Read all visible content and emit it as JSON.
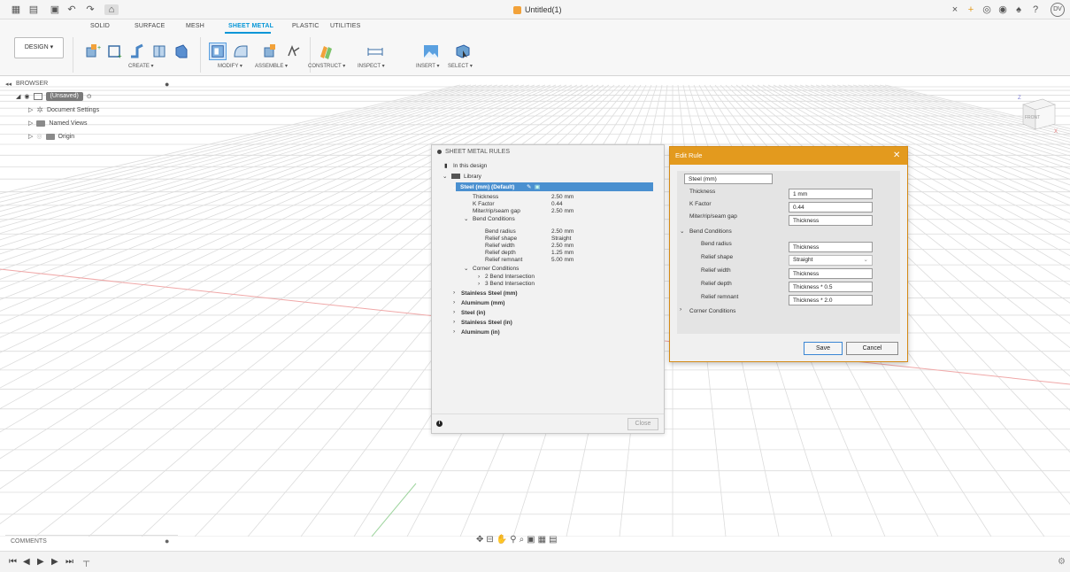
{
  "document": {
    "title": "Untitled(1)"
  },
  "user": {
    "initials": "DV"
  },
  "ribbon": {
    "tabs": [
      "SOLID",
      "SURFACE",
      "MESH",
      "SHEET METAL",
      "PLASTIC",
      "UTILITIES"
    ],
    "active_tab": "SHEET METAL",
    "design_button": "DESIGN ▾",
    "groups": [
      "CREATE ▾",
      "MODIFY ▾",
      "ASSEMBLE ▾",
      "CONSTRUCT ▾",
      "INSPECT ▾",
      "INSERT ▾",
      "SELECT ▾"
    ]
  },
  "browser": {
    "header": "BROWSER",
    "root": "(Unsaved)",
    "items": [
      "Document Settings",
      "Named Views",
      "Origin"
    ]
  },
  "sheet_metal_rules": {
    "title": "SHEET METAL RULES",
    "in_this_design": "In this design",
    "library": "Library",
    "selected_rule": "Steel (mm) (Default)",
    "props": [
      {
        "label": "Thickness",
        "value": "2.50 mm"
      },
      {
        "label": "K Factor",
        "value": "0.44"
      },
      {
        "label": "Miter/rip/seam gap",
        "value": "2.50 mm"
      }
    ],
    "bend_conditions": "Bend Conditions",
    "bend_props": [
      {
        "label": "Bend radius",
        "value": "2.50 mm"
      },
      {
        "label": "Relief shape",
        "value": "Straight"
      },
      {
        "label": "Relief width",
        "value": "2.50 mm"
      },
      {
        "label": "Relief depth",
        "value": "1.25 mm"
      },
      {
        "label": "Relief remnant",
        "value": "5.00 mm"
      }
    ],
    "corner_conditions": "Corner Conditions",
    "corner_items": [
      "2 Bend Intersection",
      "3 Bend Intersection"
    ],
    "other_rules": [
      "Stainless Steel (mm)",
      "Aluminum (mm)",
      "Steel (in)",
      "Stainless Steel (in)",
      "Aluminum (in)"
    ],
    "close_label": "Close"
  },
  "edit_rule": {
    "title": "Edit Rule",
    "name_value": "Steel (mm)",
    "fields": [
      {
        "label": "Thickness",
        "value": "1 mm"
      },
      {
        "label": "K Factor",
        "value": "0.44"
      },
      {
        "label": "Miter/rip/seam gap",
        "value": "Thickness"
      }
    ],
    "bend_conditions": "Bend Conditions",
    "bend_fields": [
      {
        "label": "Bend radius",
        "value": "Thickness"
      },
      {
        "label": "Relief shape",
        "value": "Straight"
      },
      {
        "label": "Relief width",
        "value": "Thickness"
      },
      {
        "label": "Relief depth",
        "value": "Thickness * 0.5"
      },
      {
        "label": "Relief remnant",
        "value": "Thickness * 2.0"
      }
    ],
    "corner_conditions": "Corner Conditions",
    "save_label": "Save",
    "cancel_label": "Cancel"
  },
  "viewcube": {
    "face": "FRONT",
    "axis_x": "X",
    "axis_z": "Z"
  },
  "comments": {
    "label": "COMMENTS"
  }
}
